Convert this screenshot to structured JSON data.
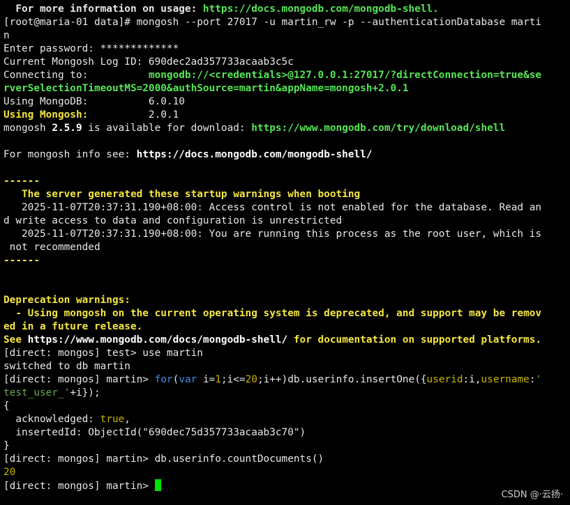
{
  "terminal": {
    "l01": {
      "a": "  For more information on usage: ",
      "b": "https://docs.mongodb.com/mongodb-shell."
    },
    "l02": "[root@maria-01 data]# mongosh --port 27017 -u martin_rw -p --authenticationDatabase marti",
    "l03": "n",
    "l04": "Enter password: *************",
    "l05": "Current Mongosh Log ID: 690dec2ad357733acaab3c5c",
    "l06": {
      "a": "Connecting to:          ",
      "b": "mongodb://<credentials>@127.0.0.1:27017/?directConnection=true&se"
    },
    "l07": "rverSelectionTimeoutMS=2000&authSource=martin&appName=mongosh+2.0.1",
    "l08": {
      "a": "Using MongoDB:",
      "b": "          6.0.10"
    },
    "l09": {
      "a": "Using Mongosh:",
      "b": "          2.0.1"
    },
    "l10": {
      "a": "mongosh ",
      "b": "2.5.9",
      "c": " is available for download: ",
      "d": "https://www.mongodb.com/try/download/shell"
    },
    "l11": "",
    "l12": {
      "a": "For mongosh info see: ",
      "b": "https://docs.mongodb.com/mongodb-shell/"
    },
    "l13": "",
    "l14": "------",
    "l15": "   The server generated these startup warnings when booting",
    "l16": "   2025-11-07T20:37:31.190+08:00: Access control is not enabled for the database. Read an",
    "l17": "d write access to data and configuration is unrestricted",
    "l18": "   2025-11-07T20:37:31.190+08:00: You are running this process as the root user, which is",
    "l19": " not recommended",
    "l20": "------",
    "l21": "",
    "l22": "",
    "l23": "Deprecation warnings:",
    "l24": "  - Using mongosh on the current operating system is deprecated, and support may be remov",
    "l25": "ed in a future release.",
    "l26": {
      "a": "See ",
      "b": "https://www.mongodb.com/docs/mongodb-shell/",
      "c": " for documentation on supported platforms."
    },
    "l27": "[direct: mongos] test> use martin",
    "l28": "switched to db martin",
    "l29": {
      "prompt": "[direct: mongos] martin> ",
      "kw_for": "for",
      "p1": "(",
      "kw_var": "var",
      "p2": " i=",
      "n1": "1",
      "p3": ";i<=",
      "n2": "20",
      "p4": ";i++)db.userinfo.insertOne({",
      "k1": "userid",
      "p5": ":i,",
      "k2": "username",
      "p6": ":",
      "s1": "'"
    },
    "l30": {
      "s": "test_user_'",
      "rest": "+i});"
    },
    "l31": "{",
    "l32": {
      "a": "  acknowledged: ",
      "b": "true",
      "c": ","
    },
    "l33": "  insertedId: ObjectId(\"690dec75d357733acaab3c70\")",
    "l34": "}",
    "l35": "[direct: mongos] martin> db.userinfo.countDocuments()",
    "l36": "20",
    "l37": "[direct: mongos] martin> "
  },
  "watermark": "CSDN @·云扬·",
  "colors": {
    "background": "#000000",
    "text": "#e8e8e8",
    "green": "#55e655",
    "yellow": "#f5e642",
    "keyword_blue": "#3b8eea",
    "cursor": "#00e000"
  }
}
